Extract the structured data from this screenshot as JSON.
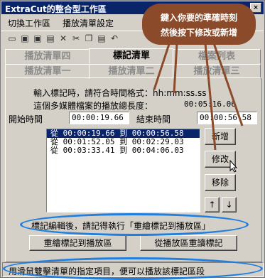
{
  "window": {
    "title": "ExtraCut的整合型工作區"
  },
  "menu": [
    "切換工作區",
    "播放清單設定"
  ],
  "toolbar": {
    "icons": [
      "open-icon",
      "save-icon",
      "save-as-icon",
      "save-all-icon",
      "delete-icon",
      "cut-icon",
      "copy-icon",
      "paste-icon",
      "undo-icon",
      "help-icon"
    ]
  },
  "tabs": {
    "row1": [
      "播放清單四",
      "標記清單",
      "檔案列表"
    ],
    "row2": [
      "播放清單一",
      "播放清單二",
      "播放清單三"
    ],
    "active": "標記清單"
  },
  "panel": {
    "instruction": "輸入標記時，請符合時間格式：hh:mm:ss.ss",
    "length_label": "這個多媒體檔案的播放總長度：",
    "length_value": "00:05:16.06",
    "start_label": "開始時間",
    "start_value": "00:00:19.66",
    "end_label": "結束時間",
    "end_value": "00:00:56.58"
  },
  "marks": [
    "從  00:00:19.66  到  00:00:56.58",
    "從  00:01:52.05  到  00:02:29.03",
    "從  00:03:33.41  到  00:04:06.03"
  ],
  "buttons": {
    "add": "新增",
    "edit": "修改",
    "remove": "移除",
    "up": "↑",
    "down": "↓",
    "redraw": "重繪標記到播放區",
    "reread": "從播放區重讀標記"
  },
  "notice": "標記編輯後，請記得執行「重繪標記到播放區」",
  "status": "用滑鼠雙擊清單的指定項目，便可以播放該標記區段",
  "callout": {
    "line1": "鍵入你要的準確時刻",
    "line2": "然後按下修改或新增"
  },
  "colors": {
    "titlebar": "#0a246a",
    "selection": "#0a246a",
    "callout": "#8b4a2a",
    "highlight": "#1f7fe0"
  }
}
